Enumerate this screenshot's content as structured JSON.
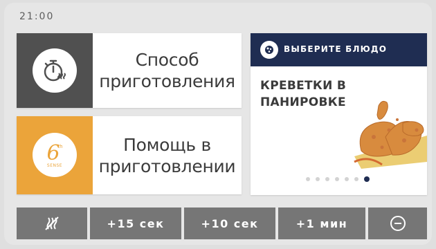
{
  "status": {
    "time": "21:00"
  },
  "tiles": [
    {
      "label": "Способ\nприготовления",
      "icon": "timer-steam-icon",
      "accent": "#505050"
    },
    {
      "label": "Помощь в\nприготовлении",
      "icon": "6th-sense-logo-icon",
      "accent": "#eba43a",
      "logo_text": "6",
      "logo_sub": "SENSE"
    }
  ],
  "featured": {
    "header": "ВЫБЕРИТЕ БЛЮДО",
    "header_icon": "dish-icon",
    "dish": "КРЕВЕТКИ В\nПАНИРОВКЕ",
    "page_count": 7,
    "current_page": 7,
    "header_color": "#1f2d52"
  },
  "bottom_bar": {
    "icon_left": "steam-off-icon",
    "buttons": [
      "+15 сек",
      "+10 сек",
      "+1 мин"
    ],
    "icon_right": "minus-circle-icon"
  }
}
